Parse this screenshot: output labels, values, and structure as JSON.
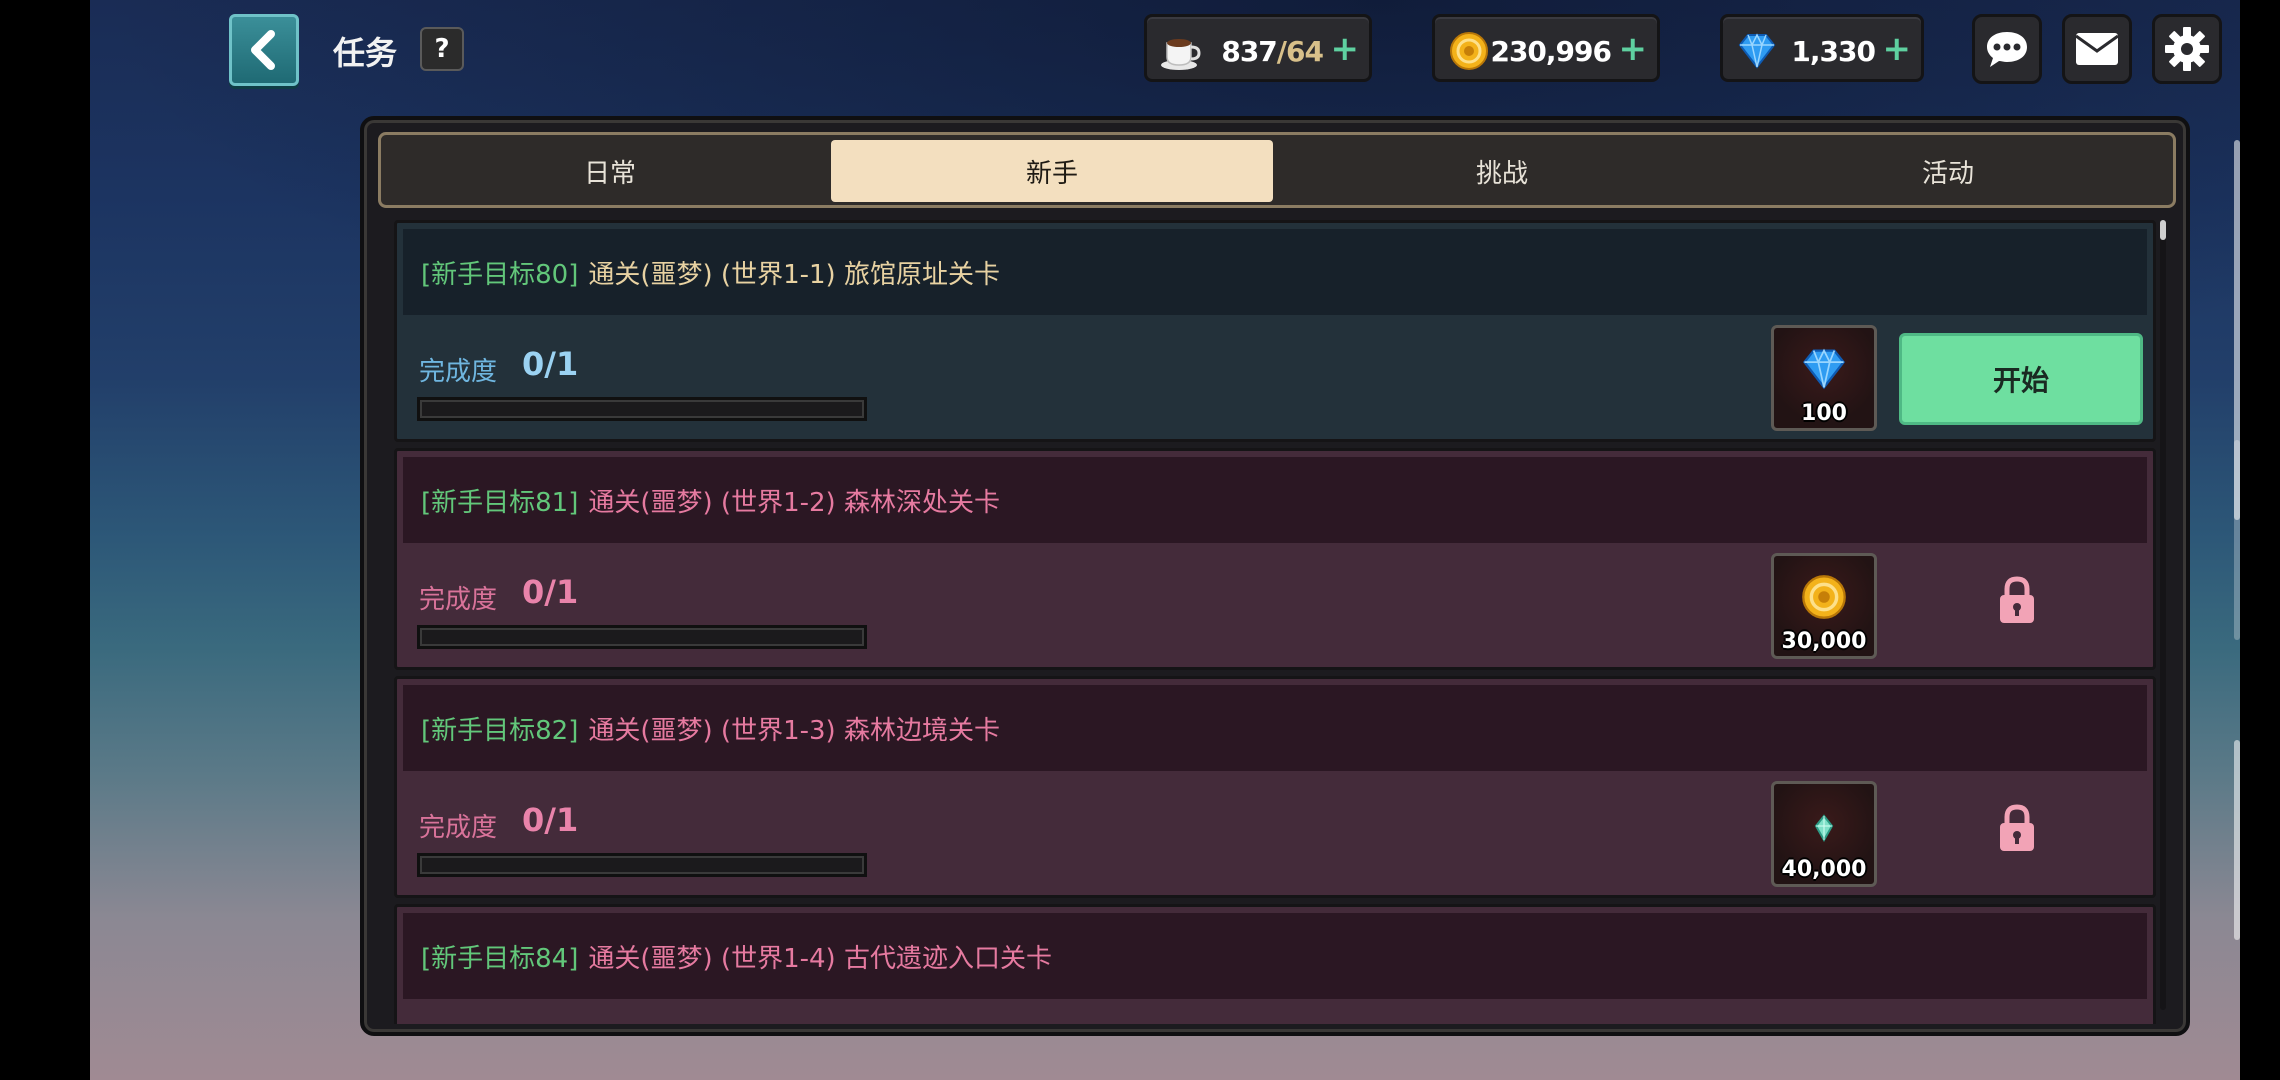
{
  "header": {
    "title": "任务",
    "help_label": "?"
  },
  "resources": {
    "stamina": {
      "value": "837",
      "max": "/64",
      "icon": "coffee-cup-icon"
    },
    "gold": {
      "value": "230,996",
      "icon": "gold-coin-icon"
    },
    "gems": {
      "value": "1,330",
      "icon": "blue-gem-icon"
    },
    "plus": "+"
  },
  "tabs": [
    {
      "label": "日常",
      "active": false
    },
    {
      "label": "新手",
      "active": true
    },
    {
      "label": "挑战",
      "active": false
    },
    {
      "label": "活动",
      "active": false
    }
  ],
  "quests": [
    {
      "tag": "[新手目标80]",
      "name": "通关(噩梦) (世界1-1) 旅馆原址关卡",
      "progress_label": "完成度",
      "progress": "0/1",
      "progress_fraction": 0,
      "reward_icon": "blue-gem-icon",
      "reward_value": "100",
      "action": "开始",
      "locked": false
    },
    {
      "tag": "[新手目标81]",
      "name": "通关(噩梦) (世界1-2) 森林深处关卡",
      "progress_label": "完成度",
      "progress": "0/1",
      "progress_fraction": 0,
      "reward_icon": "gold-coin-icon",
      "reward_value": "30,000",
      "locked": true
    },
    {
      "tag": "[新手目标82]",
      "name": "通关(噩梦) (世界1-3) 森林边境关卡",
      "progress_label": "完成度",
      "progress": "0/1",
      "progress_fraction": 0,
      "reward_icon": "green-crystal-icon",
      "reward_value": "40,000",
      "locked": true
    },
    {
      "tag": "[新手目标84]",
      "name": "通关(噩梦) (世界1-4) 古代遗迹入口关卡"
    }
  ],
  "colors": {
    "accent_green": "#6edfa0",
    "tab_active": "#f3dfbf",
    "quest_active_bg": "#23313a",
    "quest_locked_bg": "#442b3a",
    "lock_pink": "#f2a3b6"
  }
}
